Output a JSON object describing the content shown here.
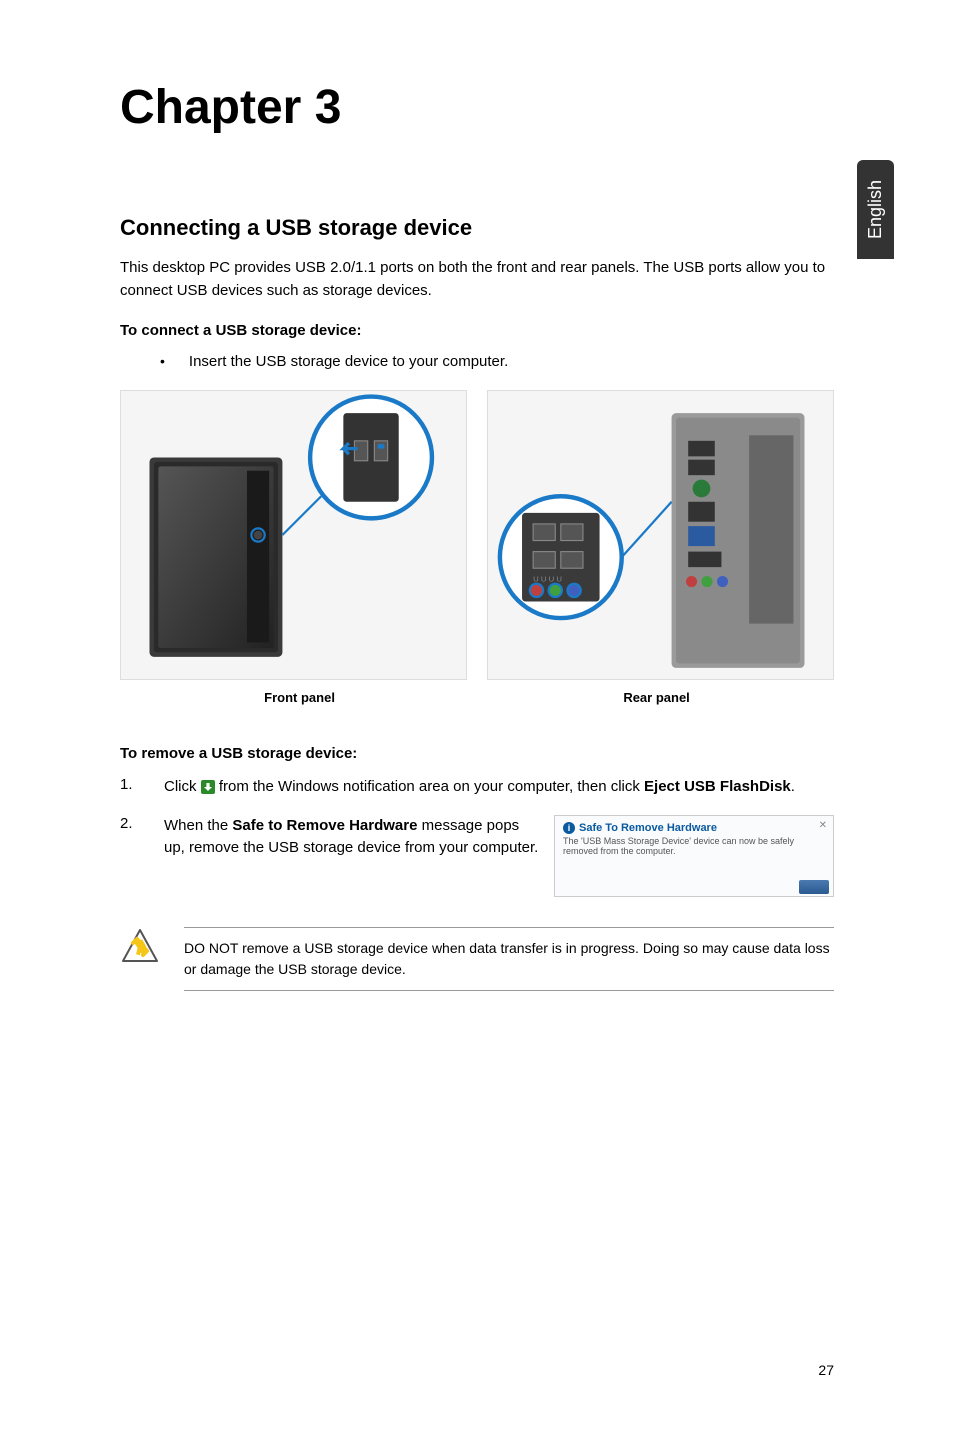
{
  "sidebar": {
    "language": "English"
  },
  "chapter": {
    "title": "Chapter 3"
  },
  "section": {
    "title": "Connecting a USB storage device",
    "intro": "This desktop PC provides USB 2.0/1.1 ports on both the front and rear panels. The USB ports allow you to connect USB devices such as storage devices."
  },
  "connect": {
    "heading": "To connect a USB storage device:",
    "bullet": "Insert the USB storage device to your computer."
  },
  "captions": {
    "front": "Front panel",
    "rear": "Rear panel"
  },
  "remove": {
    "heading": "To remove a USB storage device:",
    "step1_pre": "Click ",
    "step1_post": " from the Windows notification area on your computer, then click ",
    "step1_bold": "Eject USB FlashDisk",
    "step1_end": ".",
    "step2_pre": "When the ",
    "step2_bold": "Safe to Remove Hardware",
    "step2_post": " message pops up, remove the USB storage device from your computer."
  },
  "notification": {
    "title": "Safe To Remove Hardware",
    "body": "The 'USB Mass Storage Device' device can now be safely removed from the computer."
  },
  "warning": {
    "text": "DO NOT remove a USB storage device when data transfer is in progress. Doing so may cause data loss or damage the USB storage device."
  },
  "page": {
    "number": "27"
  },
  "list": {
    "n1": "1.",
    "n2": "2."
  }
}
